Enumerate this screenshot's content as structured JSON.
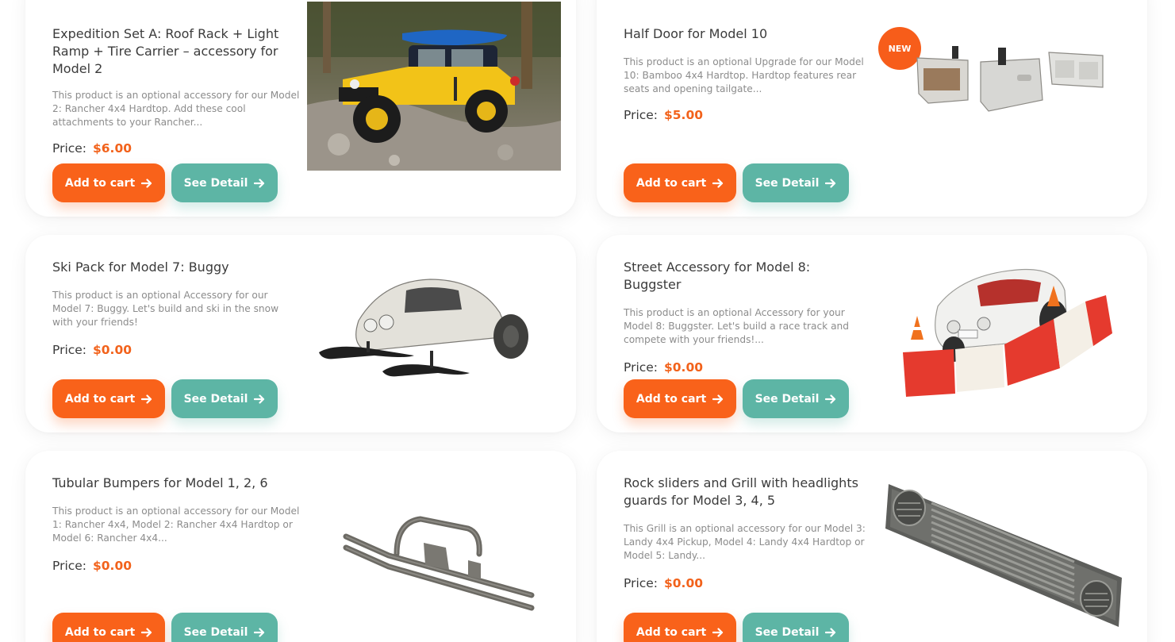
{
  "common": {
    "add_to_cart": "Add to cart",
    "see_detail": "See Detail",
    "price_label": "Price:",
    "new_badge": "NEW"
  },
  "colors": {
    "accent_orange": "#f9621a",
    "accent_teal": "#5db5a5",
    "price_orange": "#f2621b"
  },
  "products": [
    {
      "title": "Expedition Set A: Roof Rack + Light Ramp + Tire Carrier – accessory for Model 2",
      "description": "This product is an optional accessory for our Model 2: Rancher 4x4 Hardtop. Add these cool attachments to your Rancher...",
      "price": "$6.00",
      "image": "yellow-jeep-photo"
    },
    {
      "title": "Half Door for Model 10",
      "description": "This product is an optional Upgrade for our Model 10: Bamboo 4x4 Hardtop. Hardtop features rear seats and opening tailgate...",
      "price": "$5.00",
      "image": "half-door-parts",
      "badge": true
    },
    {
      "title": "Ski Pack for Model 7: Buggy",
      "description": "This product is an optional Accessory for our Model 7: Buggy. Let's build and ski in the snow with your friends!",
      "price": "$0.00",
      "image": "buggy-with-skis"
    },
    {
      "title": "Street Accessory for Model 8: Buggster",
      "description": "This product is an optional Accessory for your Model 8: Buggster. Let's build a race track and compete with your friends!...",
      "price": "$0.00",
      "image": "convertible-race-track"
    },
    {
      "title": "Tubular Bumpers for Model 1, 2, 6",
      "description": "This product is an optional accessory for our Model 1: Rancher 4x4, Model 2: Rancher 4x4 Hardtop or Model 6: Rancher 4x4...",
      "price": "$0.00",
      "image": "tubular-bumper"
    },
    {
      "title": "Rock sliders and Grill with headlights guards for Model 3, 4, 5",
      "description": "This Grill is an optional accessory for our Model 3: Landy 4x4 Pickup, Model 4: Landy 4x4 Hardtop or Model 5: Landy...",
      "price": "$0.00",
      "image": "grill-with-headlight-guards"
    }
  ]
}
